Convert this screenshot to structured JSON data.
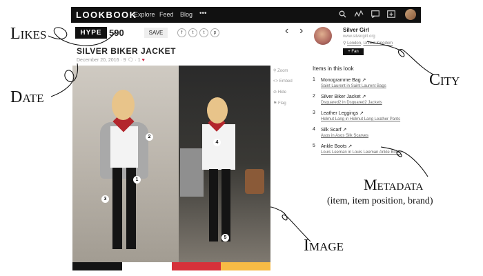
{
  "nav": {
    "logo": "LOOKBOOK",
    "links": [
      "Explore",
      "Feed",
      "Blog",
      "•••"
    ],
    "icons": [
      "search-icon",
      "activity-icon",
      "messages-icon",
      "upload-icon",
      "user-avatar"
    ]
  },
  "look": {
    "hype_label": "HYPE",
    "hype_count": "590",
    "save_label": "SAVE",
    "share_icons": [
      "facebook-icon",
      "twitter-icon",
      "tumblr-icon",
      "pinterest-icon"
    ],
    "share_glyphs": [
      "f",
      "t",
      "t",
      "p"
    ],
    "prev_arrow": "‹",
    "next_arrow": "›",
    "title": "SILVER BIKER JACKET",
    "date": "December 20, 2016",
    "comments": "9",
    "likes": "1",
    "side_actions": [
      "Zoom",
      "Embed",
      "Hide",
      "Flag"
    ],
    "markers": [
      "1",
      "2",
      "3",
      "4",
      "5"
    ],
    "swatches": [
      "#141414",
      "#ffffff",
      "#d6313a",
      "#f7bb45"
    ]
  },
  "user": {
    "name": "Silver Girl",
    "url": "www.silvergirl.org",
    "location_city": "London",
    "location_country": "United Kingdom",
    "fan_label": "+ Fan"
  },
  "items_header": "Items in this look",
  "items": [
    {
      "num": "1",
      "name": "Monogramme Bag",
      "brand": "Saint Laurent in Saint Laurent Bags"
    },
    {
      "num": "2",
      "name": "Silver Biker Jacket",
      "brand": "Dsquared2 in Dsquared2 Jackets"
    },
    {
      "num": "3",
      "name": "Leather Leggings",
      "brand": "Helmut Lang in Helmut Lang Leather Pants"
    },
    {
      "num": "4",
      "name": "Silk Scarf",
      "brand": "Asos in Asos Silk Scarves"
    },
    {
      "num": "5",
      "name": "Ankle Boots",
      "brand": "Louis Leeman in Louis Leeman Ankle Boots"
    }
  ],
  "annotations": {
    "likes": "Likes",
    "date": "Date",
    "city": "City",
    "metadata": "Metadata",
    "metadata_sub": "(item, item position, brand)",
    "image": "Image"
  }
}
